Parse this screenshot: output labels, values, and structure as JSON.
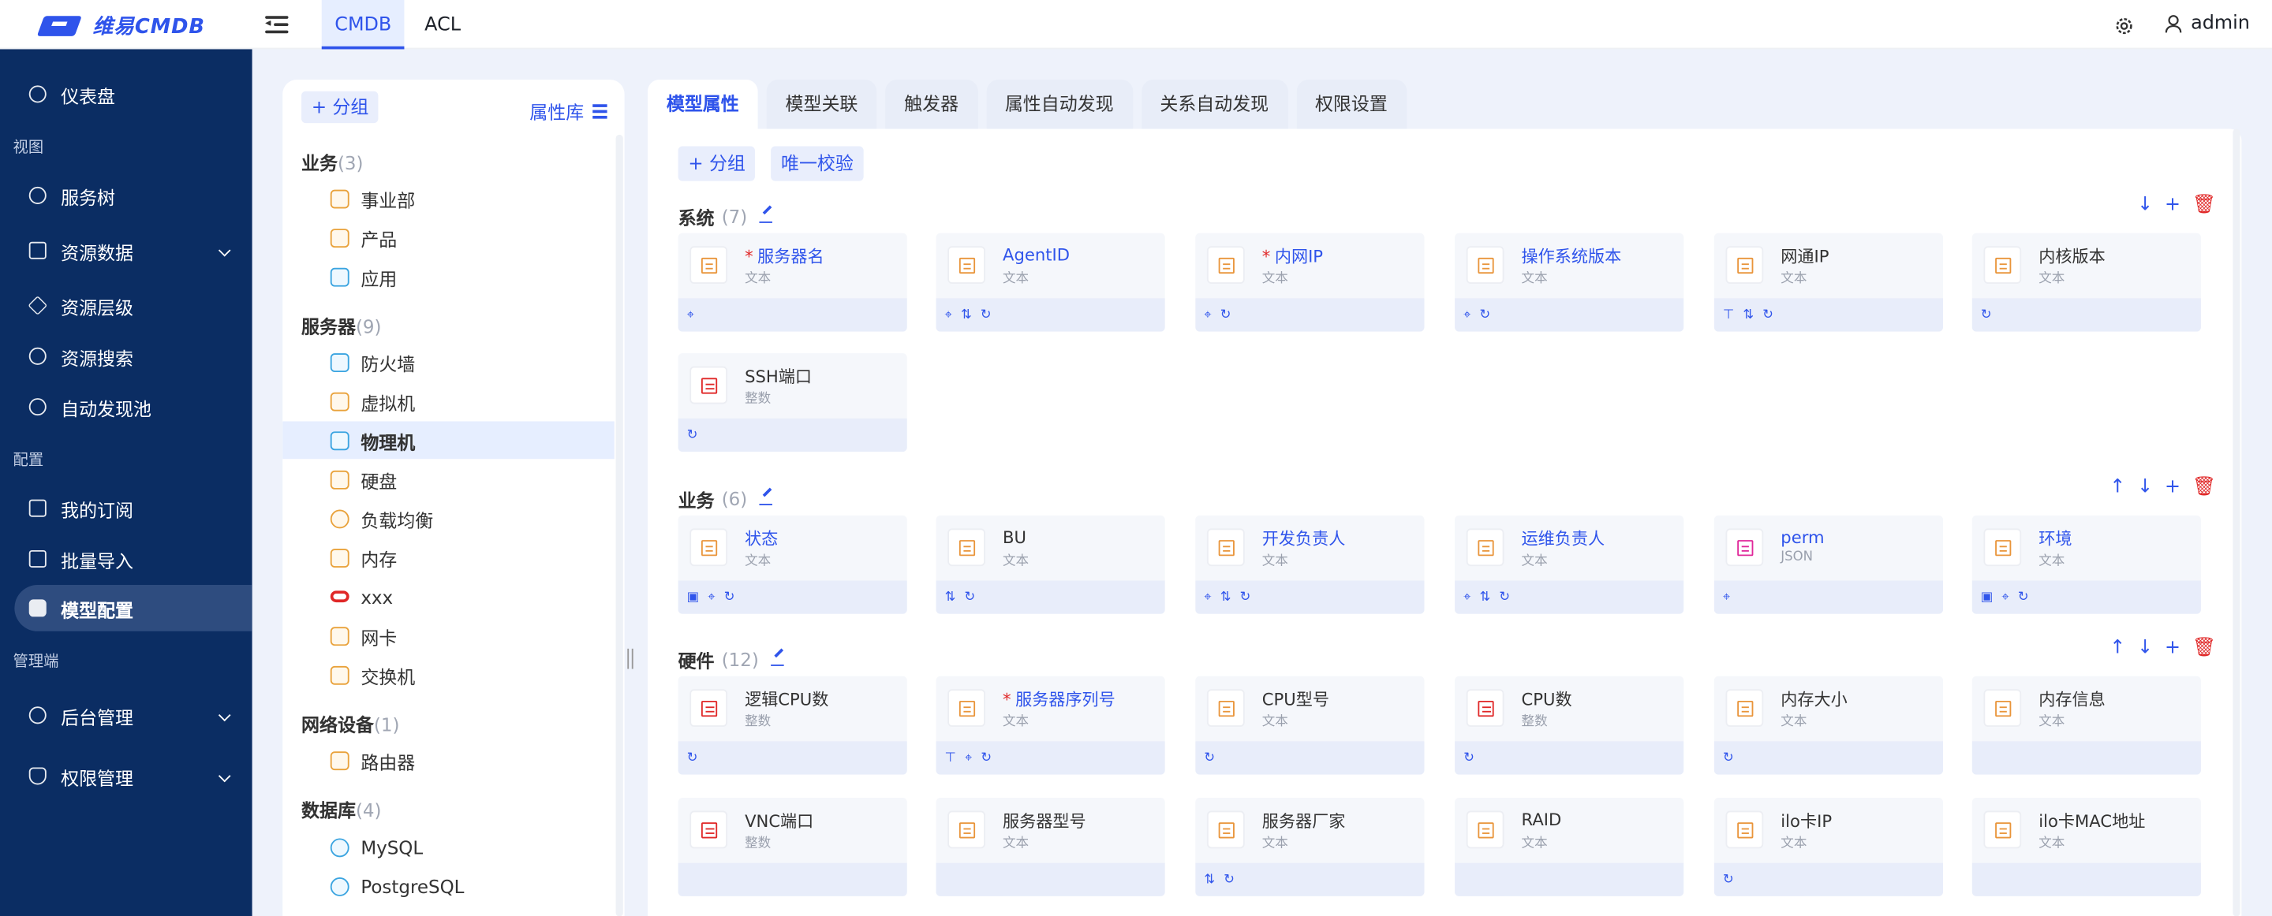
{
  "app": {
    "logo_text": "维易CMDB"
  },
  "topnav": {
    "tabs": [
      "CMDB",
      "ACL"
    ],
    "active": "CMDB",
    "user": "admin"
  },
  "sidebar": {
    "items": [
      {
        "label": "仪表盘",
        "icon": "dashboard-icon"
      },
      {
        "section": "视图"
      },
      {
        "label": "服务树",
        "icon": "tree-icon"
      },
      {
        "label": "资源数据",
        "icon": "data-icon",
        "expandable": true
      },
      {
        "label": "资源层级",
        "icon": "layers-icon"
      },
      {
        "label": "资源搜索",
        "icon": "search-icon"
      },
      {
        "label": "自动发现池",
        "icon": "discovery-icon"
      },
      {
        "section": "配置"
      },
      {
        "label": "我的订阅",
        "icon": "subscribe-icon"
      },
      {
        "label": "批量导入",
        "icon": "import-icon"
      },
      {
        "label": "模型配置",
        "icon": "model-icon",
        "active": true
      },
      {
        "section": "管理端"
      },
      {
        "label": "后台管理",
        "icon": "settings-icon",
        "expandable": true
      },
      {
        "label": "权限管理",
        "icon": "permission-icon",
        "expandable": true
      }
    ]
  },
  "left_panel": {
    "add_group": "+ 分组",
    "attr_lib": "属性库",
    "groups": [
      {
        "name": "业务",
        "count": "(3)",
        "items": [
          "事业部",
          "产品",
          "应用"
        ]
      },
      {
        "name": "服务器",
        "count": "(9)",
        "items": [
          "防火墙",
          "虚拟机",
          "物理机",
          "硬盘",
          "负载均衡",
          "内存",
          "xxx",
          "网卡",
          "交换机"
        ]
      },
      {
        "name": "网络设备",
        "count": "(1)",
        "items": [
          "路由器"
        ]
      },
      {
        "name": "数据库",
        "count": "(4)",
        "items": [
          "MySQL",
          "PostgreSQL"
        ]
      }
    ],
    "selected": "物理机"
  },
  "tabs": [
    "模型属性",
    "模型关联",
    "触发器",
    "属性自动发现",
    "关系自动发现",
    "权限设置"
  ],
  "active_tab": "模型属性",
  "toolbar": {
    "add_group": "+ 分组",
    "unique_check": "唯一校验"
  },
  "sections": [
    {
      "title": "系统",
      "count": "(7)",
      "attrs": [
        {
          "name": "服务器名",
          "type": "文本",
          "required": true,
          "kind": "text",
          "tags": [
            "⌖"
          ]
        },
        {
          "name": "AgentID",
          "type": "文本",
          "required": false,
          "link": true,
          "kind": "text",
          "tags": [
            "⌖",
            "⇅",
            "↻"
          ]
        },
        {
          "name": "内网IP",
          "type": "文本",
          "required": true,
          "kind": "text",
          "tags": [
            "⌖",
            "↻"
          ]
        },
        {
          "name": "操作系统版本",
          "type": "文本",
          "required": false,
          "link": true,
          "kind": "text",
          "tags": [
            "⌖",
            "↻"
          ]
        },
        {
          "name": "网通IP",
          "type": "文本",
          "required": false,
          "kind": "text",
          "tags": [
            "⊤",
            "⇅",
            "↻"
          ]
        },
        {
          "name": "内核版本",
          "type": "文本",
          "required": false,
          "kind": "text",
          "tags": [
            "↻"
          ]
        },
        {
          "name": "SSH端口",
          "type": "整数",
          "required": false,
          "kind": "int",
          "tags": [
            "↻"
          ]
        }
      ]
    },
    {
      "title": "业务",
      "count": "(6)",
      "attrs": [
        {
          "name": "状态",
          "type": "文本",
          "required": false,
          "link": true,
          "kind": "text",
          "tags": [
            "▣",
            "⌖",
            "↻"
          ]
        },
        {
          "name": "BU",
          "type": "文本",
          "required": false,
          "kind": "text",
          "tags": [
            "⇅",
            "↻"
          ]
        },
        {
          "name": "开发负责人",
          "type": "文本",
          "required": false,
          "link": true,
          "kind": "text",
          "tags": [
            "⌖",
            "⇅",
            "↻"
          ]
        },
        {
          "name": "运维负责人",
          "type": "文本",
          "required": false,
          "link": true,
          "kind": "text",
          "tags": [
            "⌖",
            "⇅",
            "↻"
          ]
        },
        {
          "name": "perm",
          "type": "JSON",
          "required": false,
          "link": true,
          "kind": "json",
          "tags": [
            "⌖"
          ]
        },
        {
          "name": "环境",
          "type": "文本",
          "required": false,
          "link": true,
          "kind": "text",
          "tags": [
            "▣",
            "⌖",
            "↻"
          ]
        }
      ]
    },
    {
      "title": "硬件",
      "count": "(12)",
      "attrs": [
        {
          "name": "逻辑CPU数",
          "type": "整数",
          "required": false,
          "kind": "int",
          "tags": [
            "↻"
          ]
        },
        {
          "name": "服务器序列号",
          "type": "文本",
          "required": true,
          "kind": "text",
          "tags": [
            "⊤",
            "⌖",
            "↻"
          ]
        },
        {
          "name": "CPU型号",
          "type": "文本",
          "required": false,
          "kind": "text",
          "tags": [
            "↻"
          ]
        },
        {
          "name": "CPU数",
          "type": "整数",
          "required": false,
          "kind": "int",
          "tags": [
            "↻"
          ]
        },
        {
          "name": "内存大小",
          "type": "文本",
          "required": false,
          "kind": "text",
          "tags": [
            "↻"
          ]
        },
        {
          "name": "内存信息",
          "type": "文本",
          "required": false,
          "kind": "text",
          "tags": []
        },
        {
          "name": "VNC端口",
          "type": "整数",
          "required": false,
          "kind": "int",
          "tags": []
        },
        {
          "name": "服务器型号",
          "type": "文本",
          "required": false,
          "kind": "text",
          "tags": []
        },
        {
          "name": "服务器厂家",
          "type": "文本",
          "required": false,
          "kind": "text",
          "tags": [
            "⇅",
            "↻"
          ]
        },
        {
          "name": "RAID",
          "type": "文本",
          "required": false,
          "kind": "text",
          "tags": []
        },
        {
          "name": "ilo卡IP",
          "type": "文本",
          "required": false,
          "kind": "text",
          "tags": [
            "↻"
          ]
        },
        {
          "name": "ilo卡MAC地址",
          "type": "文本",
          "required": false,
          "kind": "text",
          "tags": []
        }
      ]
    }
  ],
  "colors": {
    "primary": "#2f54eb",
    "sidebar_bg": "#0b2d63",
    "danger": "#e02828"
  }
}
